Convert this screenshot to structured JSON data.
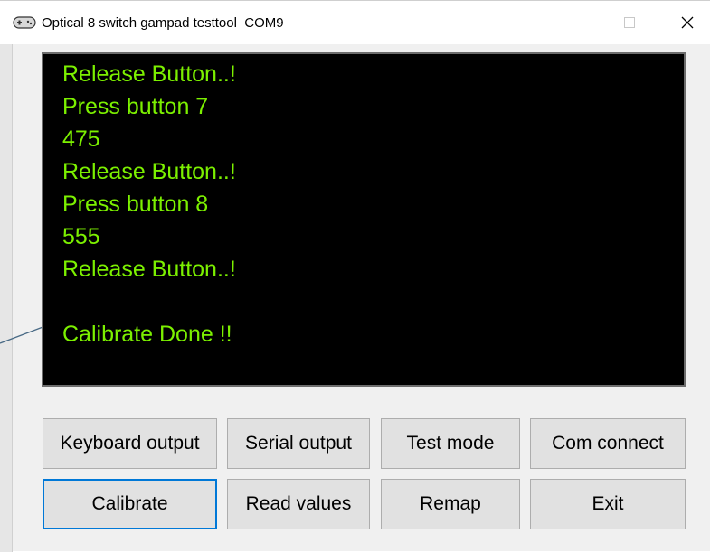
{
  "window": {
    "title": "Optical 8 switch gampad testtool  COM9",
    "app_icon": "gamepad-icon",
    "controls": {
      "minimize_icon": "minimize-icon",
      "maximize_icon": "maximize-icon",
      "close_icon": "close-icon"
    }
  },
  "console": {
    "background": "#000000",
    "text_color": "#7cf000",
    "lines": [
      "Release Button..!",
      "Press button 7",
      "475",
      "Release Button..!",
      "Press button 8",
      "555",
      "Release Button..!",
      "",
      "Calibrate Done !!"
    ]
  },
  "buttons": {
    "keyboard_output": "Keyboard output",
    "serial_output": "Serial output",
    "test_mode": "Test mode",
    "com_connect": "Com connect",
    "calibrate": "Calibrate",
    "read_values": "Read values",
    "remap": "Remap",
    "exit": "Exit"
  },
  "colors": {
    "focus_accent": "#0078d7",
    "button_face": "#e1e1e1"
  }
}
